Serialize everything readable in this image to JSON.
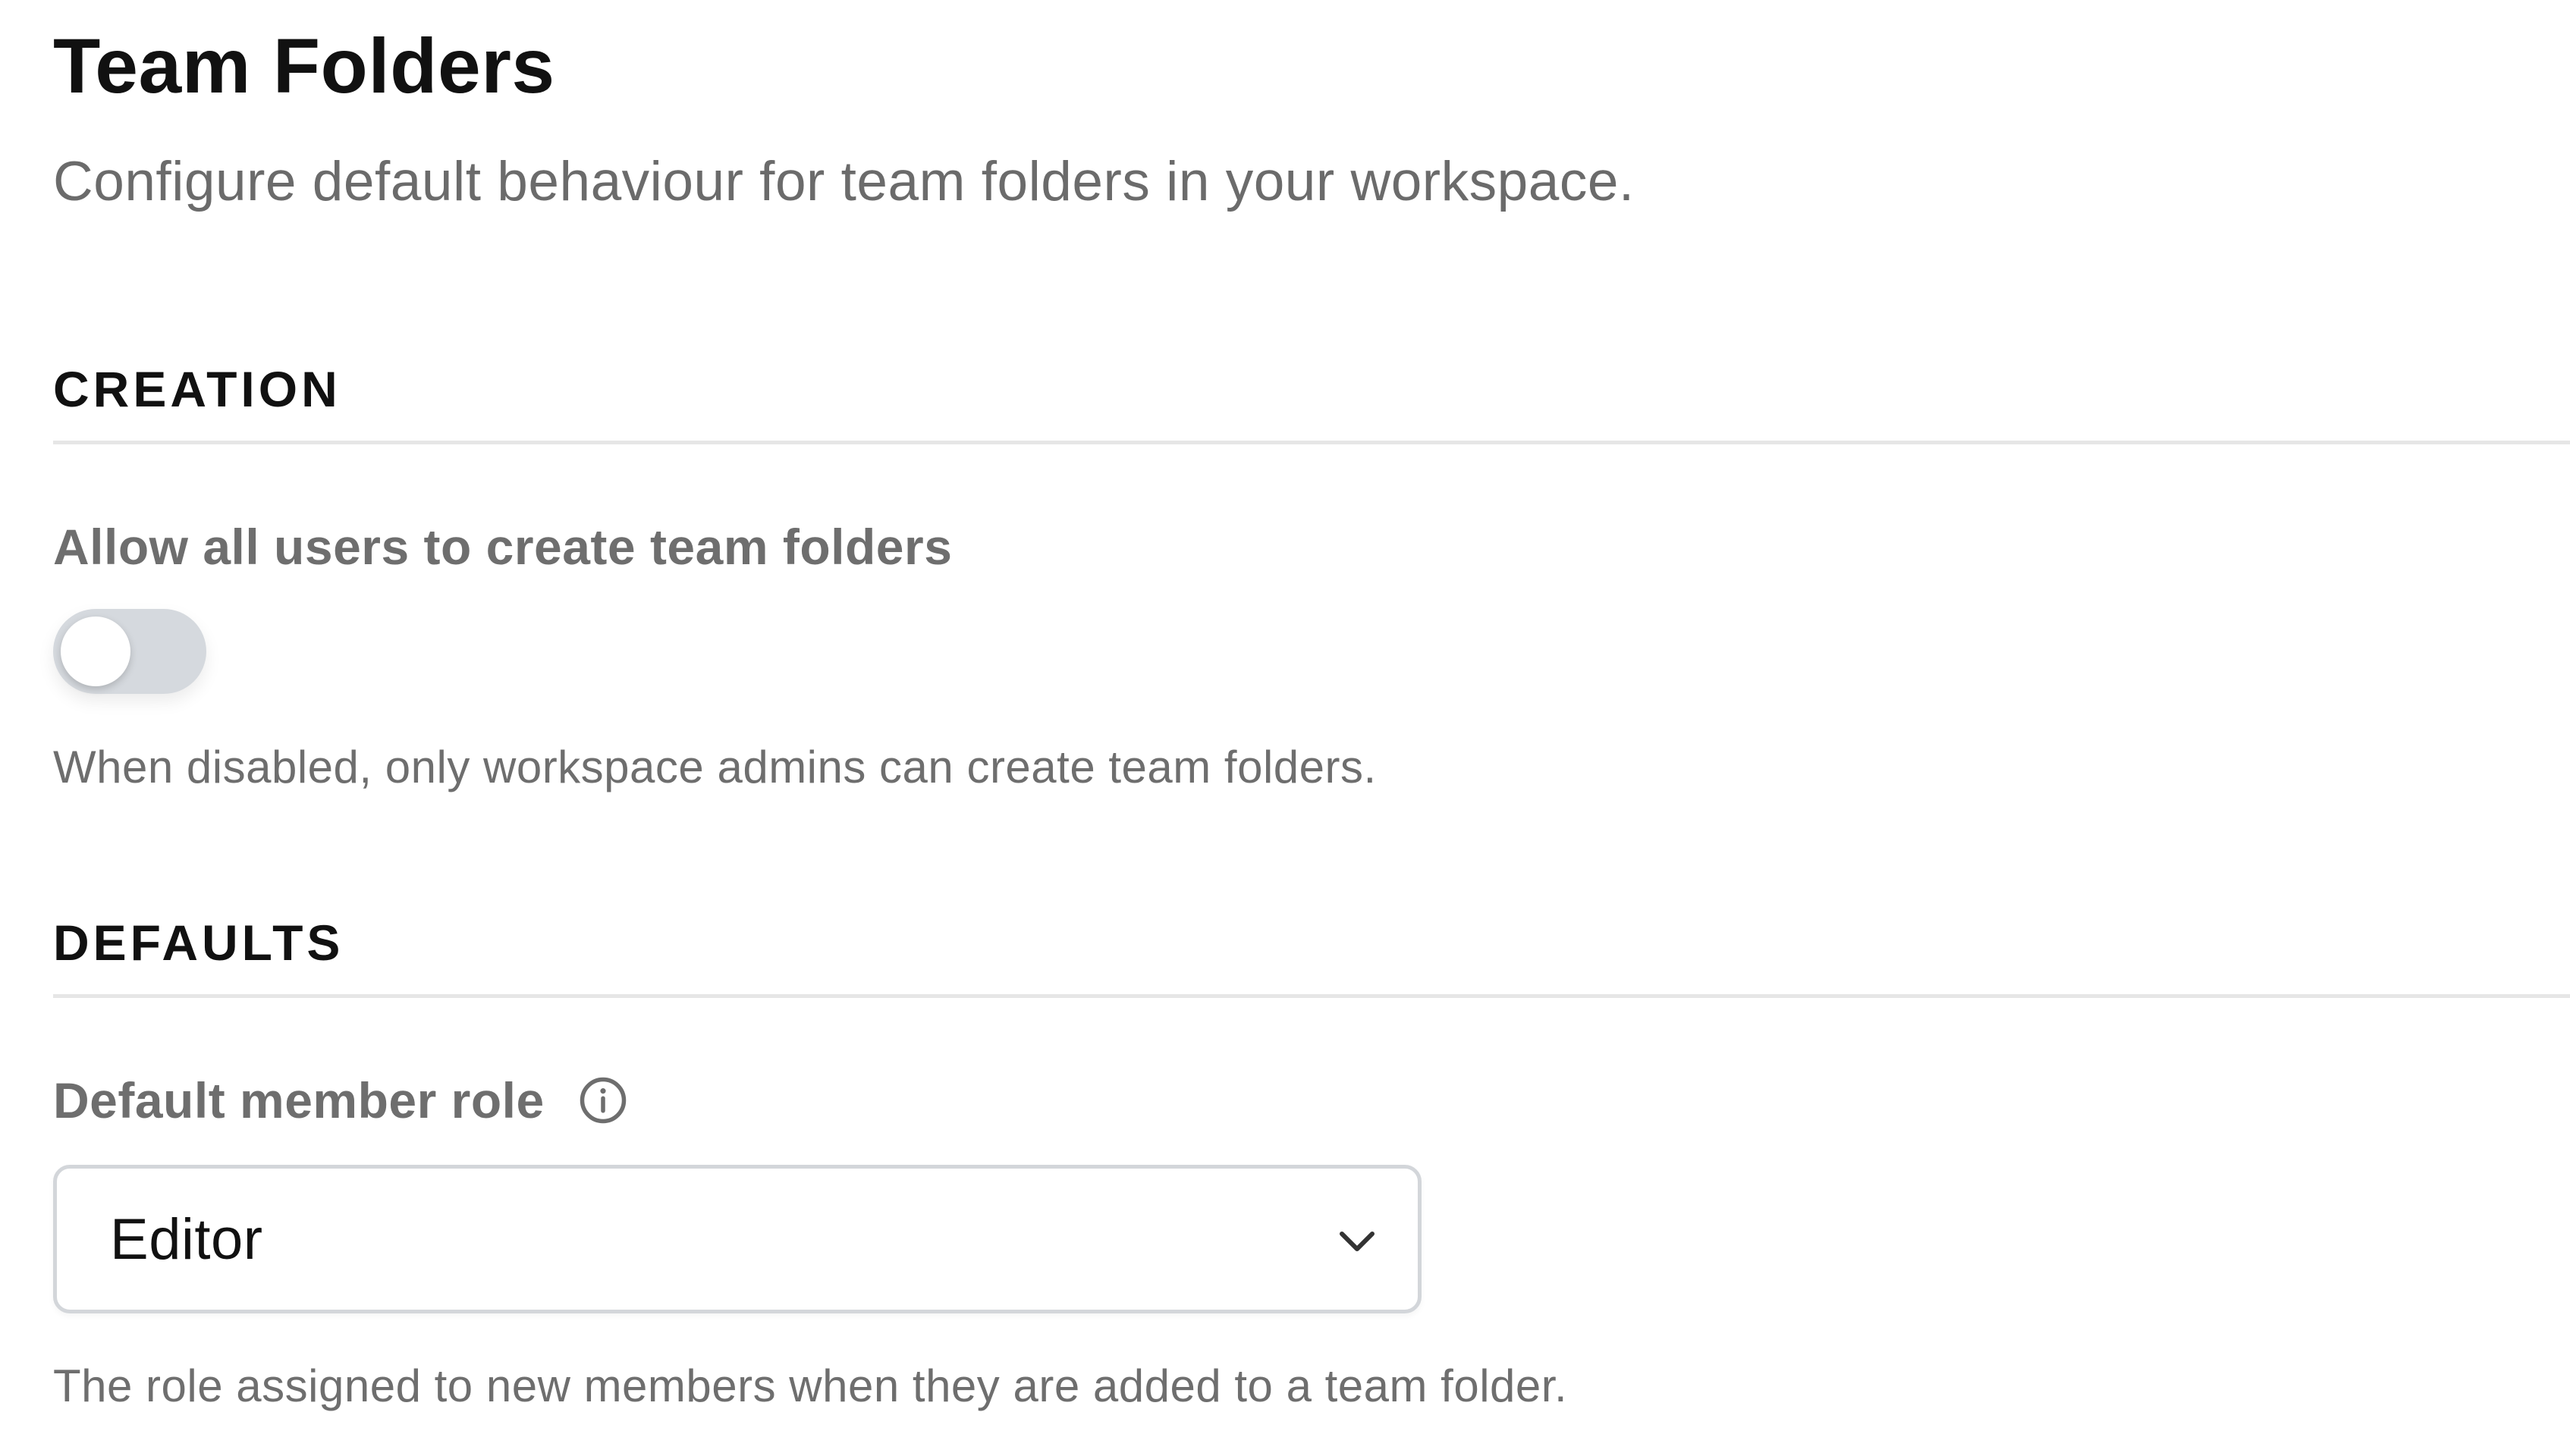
{
  "header": {
    "title": "Team Folders",
    "subtitle": "Configure default behaviour for team folders in your workspace."
  },
  "sections": {
    "creation": {
      "heading": "CREATION",
      "allow_create": {
        "label": "Allow all users to create team folders",
        "enabled": false,
        "help": "When disabled, only workspace admins can create team folders."
      }
    },
    "defaults": {
      "heading": "DEFAULTS",
      "member_role": {
        "label": "Default member role",
        "info_icon": "info-circle-icon",
        "selected": "Editor",
        "dropdown_icon": "chevron-down-icon",
        "help": "The role assigned to new members when they are added to a team folder."
      }
    }
  },
  "colors": {
    "toggle_off_track": "#d5d9de",
    "toggle_knob": "#ffffff",
    "divider": "#e6e6e6",
    "muted_text": "#6e6e6e",
    "strong_text": "#111111"
  }
}
